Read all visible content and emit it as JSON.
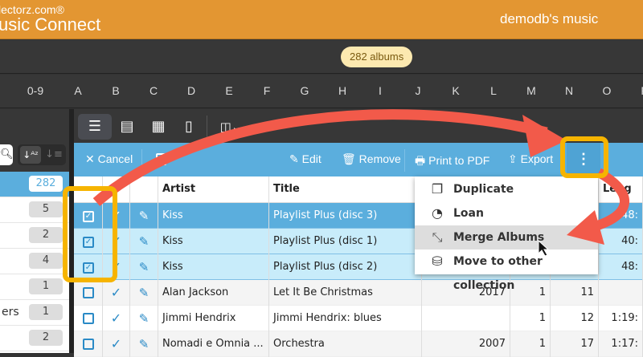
{
  "header": {
    "brand_top": "lectorz.com®",
    "brand_app": "usic Connect",
    "collection": "demodb's music"
  },
  "count_badge": "282 albums",
  "letters": [
    "0-9",
    "A",
    "B",
    "C",
    "D",
    "E",
    "F",
    "G",
    "H",
    "I",
    "J",
    "K",
    "L",
    "M",
    "N",
    "O",
    "P"
  ],
  "sidebar": {
    "items": [
      {
        "label": "",
        "count": "282"
      },
      {
        "label": "",
        "count": "5"
      },
      {
        "label": "",
        "count": "2"
      },
      {
        "label": "",
        "count": "4"
      },
      {
        "label": "",
        "count": "1"
      },
      {
        "label": "ers",
        "count": "1"
      },
      {
        "label": "",
        "count": "2"
      }
    ]
  },
  "toolbar": {
    "cancel": "Cancel",
    "edit": "Edit",
    "remove": "Remove",
    "print": "Print to PDF",
    "export": "Export"
  },
  "table": {
    "headers": [
      "Artist",
      "Title",
      "",
      "",
      "",
      "Leng"
    ],
    "rows": [
      {
        "artist": "Kiss",
        "title": "Playlist Plus (disc 3)",
        "year": "",
        "discs": "",
        "tracks": "",
        "length": "48:",
        "checked": true
      },
      {
        "artist": "Kiss",
        "title": "Playlist Plus (disc 1)",
        "year": "",
        "discs": "",
        "tracks": "",
        "length": "40:",
        "checked": true
      },
      {
        "artist": "Kiss",
        "title": "Playlist Plus (disc 2)",
        "year": "",
        "discs": "",
        "tracks": "",
        "length": "48:",
        "checked": true
      },
      {
        "artist": "Alan Jackson",
        "title": "Let It Be Christmas",
        "year": "2017",
        "discs": "1",
        "tracks": "11",
        "length": "",
        "checked": false
      },
      {
        "artist": "Jimmi Hendrix",
        "title": "Jimmi Hendrix: blues",
        "year": "",
        "discs": "1",
        "tracks": "12",
        "length": "1:19:",
        "checked": false
      },
      {
        "artist": "Nomadi e Omnia ...",
        "title": "Orchestra",
        "year": "2007",
        "discs": "1",
        "tracks": "17",
        "length": "1:17:",
        "checked": false
      }
    ]
  },
  "menu": {
    "items": [
      "Duplicate",
      "Loan",
      "Merge Albums",
      "Move to other collection"
    ]
  },
  "colors": {
    "orange": "#e39632",
    "blue": "#5baedd",
    "highlight": "#f6b400",
    "arrow": "#f25a4a"
  }
}
